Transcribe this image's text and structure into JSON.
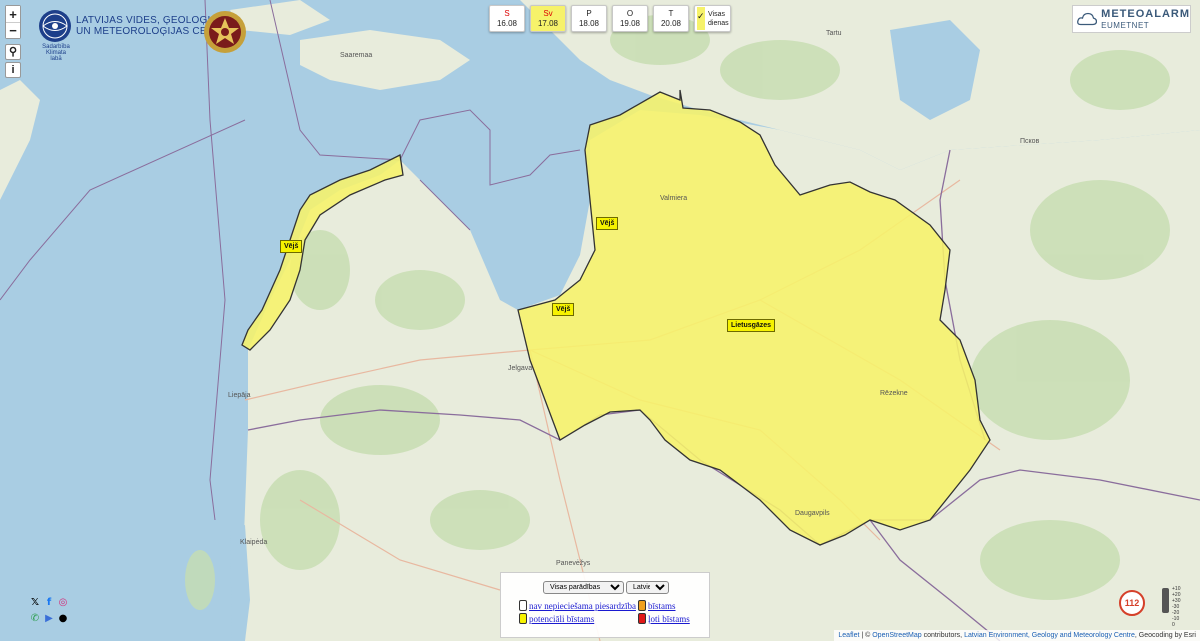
{
  "map": {
    "zoom_in": "+",
    "zoom_out": "−",
    "search_glyph": "⚲",
    "info_glyph": "i",
    "place_names": {
      "saaremaa": "Saaremaa",
      "tartu": "Tartu",
      "pskov": "Псков",
      "jelgava": "Jelgava",
      "liepaja": "Liepāja",
      "klaipeda": "Klaipėda",
      "panevezys": "Panevėžys",
      "daugavpils": "Daugavpils",
      "rezekne": "Rēzekne",
      "valmiera": "Valmiera"
    },
    "colors": {
      "sea": "#a9cde3",
      "land": "#e8ecdc",
      "forest": "#c6ddb0",
      "warning_yellow": "#f6f26a",
      "border_purple": "#8a6d9c"
    }
  },
  "header": {
    "lvgmc_line1": "LATVIJAS VIDES, ĢEOLOĢIJAS",
    "lvgmc_line2": "UN METEOROLOĢIJAS CENTRS",
    "lvgmc_sub": "Sadarbība Klimata labā",
    "meteoalarm_title": "METEOALARM",
    "meteoalarm_sub": "EUMETNET"
  },
  "days": [
    {
      "name": "S",
      "date": "16.08",
      "weekend": true,
      "selected": false
    },
    {
      "name": "Sv",
      "date": "17.08",
      "weekend": true,
      "selected": true
    },
    {
      "name": "P",
      "date": "18.08",
      "weekend": false,
      "selected": false
    },
    {
      "name": "O",
      "date": "19.08",
      "weekend": false,
      "selected": false
    },
    {
      "name": "T",
      "date": "20.08",
      "weekend": false,
      "selected": false
    }
  ],
  "all_days": {
    "line1": "Visas",
    "line2": "dienas",
    "checked": true
  },
  "warnings": [
    {
      "label": "Vējš"
    },
    {
      "label": "Vējš"
    },
    {
      "label": "Vējš"
    },
    {
      "label": "Lietusgāzes"
    }
  ],
  "legend": {
    "filter_selected": "Visas parādības",
    "language_selected": "Latviešu",
    "items": [
      {
        "label": "nav nepieciešama piesardzība",
        "color": "#ffffff"
      },
      {
        "label": "bīstams",
        "color": "#f0a020"
      },
      {
        "label": "potenciāli bīstams",
        "color": "#f6f200"
      },
      {
        "label": "ļoti bīstams",
        "color": "#e01818"
      }
    ]
  },
  "emergency": {
    "number": "112"
  },
  "scale_ticks": [
    "+10",
    "+20",
    "+30",
    "-30",
    "-20",
    "-10",
    "0"
  ],
  "attribution": {
    "leaflet": "Leaflet",
    "sep": " | © ",
    "osm": "OpenStreetMap",
    "text1": " contributors, ",
    "lvgmc": "Latvian Environment, Geology and Meteorology Centre",
    "text2": ", Geocoding by Esri"
  }
}
